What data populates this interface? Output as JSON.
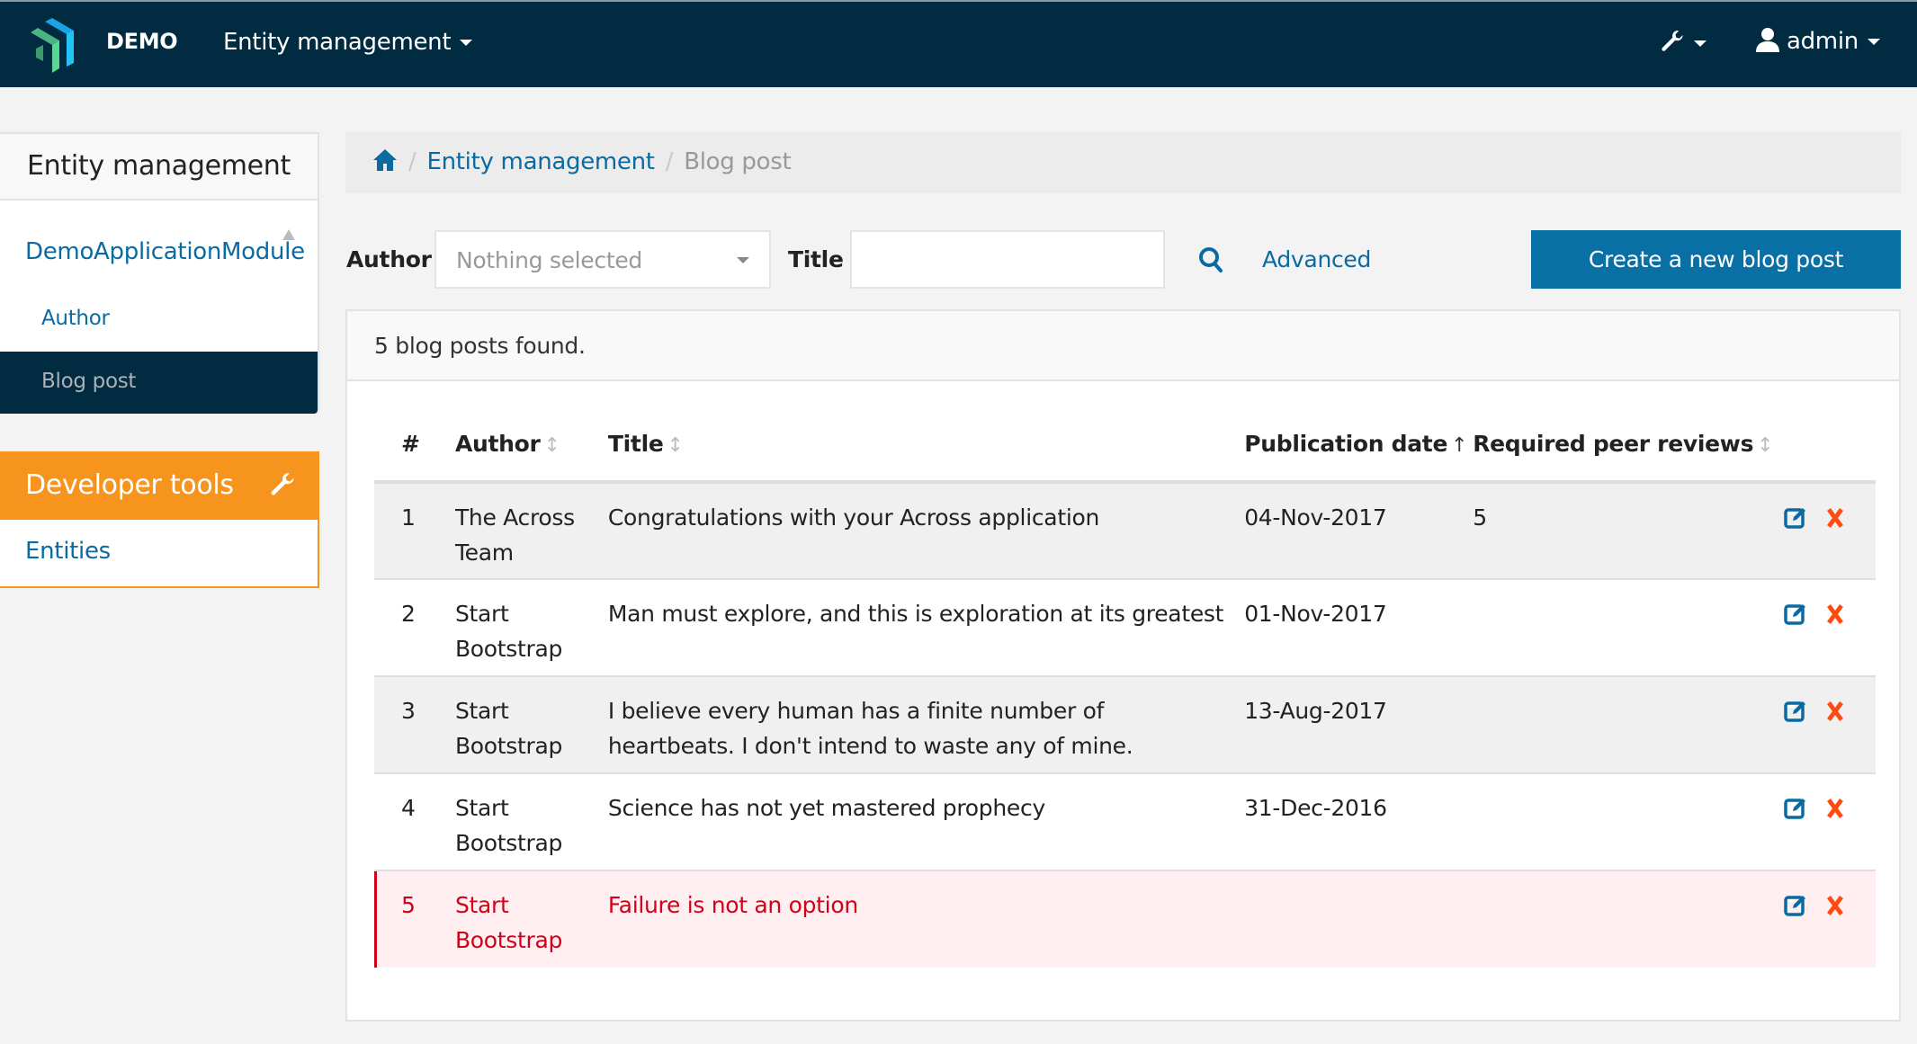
{
  "navbar": {
    "brand": "DEMO",
    "entity_menu": "Entity management",
    "tools_icon": "wrench-icon",
    "user": "admin",
    "user_icon": "user-icon"
  },
  "sidebar": {
    "title": "Entity management",
    "module": "DemoApplicationModule",
    "items": [
      {
        "label": "Author",
        "active": false
      },
      {
        "label": "Blog post",
        "active": true
      }
    ],
    "dev_tools": {
      "title": "Developer tools",
      "icon": "wrench-icon",
      "items": [
        {
          "label": "Entities"
        }
      ]
    }
  },
  "breadcrumb": {
    "home_icon": "home-icon",
    "items": [
      "Entity management",
      "Blog post"
    ]
  },
  "filters": {
    "author_label": "Author",
    "author_placeholder": "Nothing selected",
    "title_label": "Title",
    "title_value": "",
    "search_icon": "search-icon",
    "advanced_label": "Advanced",
    "create_label": "Create a new blog post"
  },
  "results": {
    "summary": "5 blog posts found.",
    "columns": [
      {
        "label": "#",
        "sort": "none"
      },
      {
        "label": "Author",
        "sort": "sortable"
      },
      {
        "label": "Title",
        "sort": "sortable"
      },
      {
        "label": "Publication date",
        "sort": "ascending"
      },
      {
        "label": "Required peer reviews",
        "sort": "sortable"
      }
    ],
    "rows": [
      {
        "num": "1",
        "author": "The Across Team",
        "title": "Congratulations with your Across application",
        "date": "04-Nov-2017",
        "reviews": "5",
        "status": "normal"
      },
      {
        "num": "2",
        "author": "Start Bootstrap",
        "title": "Man must explore, and this is exploration at its greatest",
        "date": "01-Nov-2017",
        "reviews": "",
        "status": "normal"
      },
      {
        "num": "3",
        "author": "Start Bootstrap",
        "title": "I believe every human has a finite number of heartbeats. I don't intend to waste any of mine.",
        "date": "13-Aug-2017",
        "reviews": "",
        "status": "normal"
      },
      {
        "num": "4",
        "author": "Start Bootstrap",
        "title": "Science has not yet mastered prophecy",
        "date": "31-Dec-2016",
        "reviews": "",
        "status": "normal"
      },
      {
        "num": "5",
        "author": "Start Bootstrap",
        "title": "Failure is not an option",
        "date": "",
        "reviews": "",
        "status": "danger"
      }
    ],
    "row_actions": {
      "edit_icon": "edit-icon",
      "delete_icon": "delete-icon"
    }
  },
  "colors": {
    "navbar": "#002b40",
    "primary": "#0870a5",
    "link": "#0a6aa1",
    "dev_tools": "#f7941d",
    "danger_text": "#d0021b",
    "danger_bg": "#ffeff0",
    "delete_icon": "#ff4a12"
  }
}
